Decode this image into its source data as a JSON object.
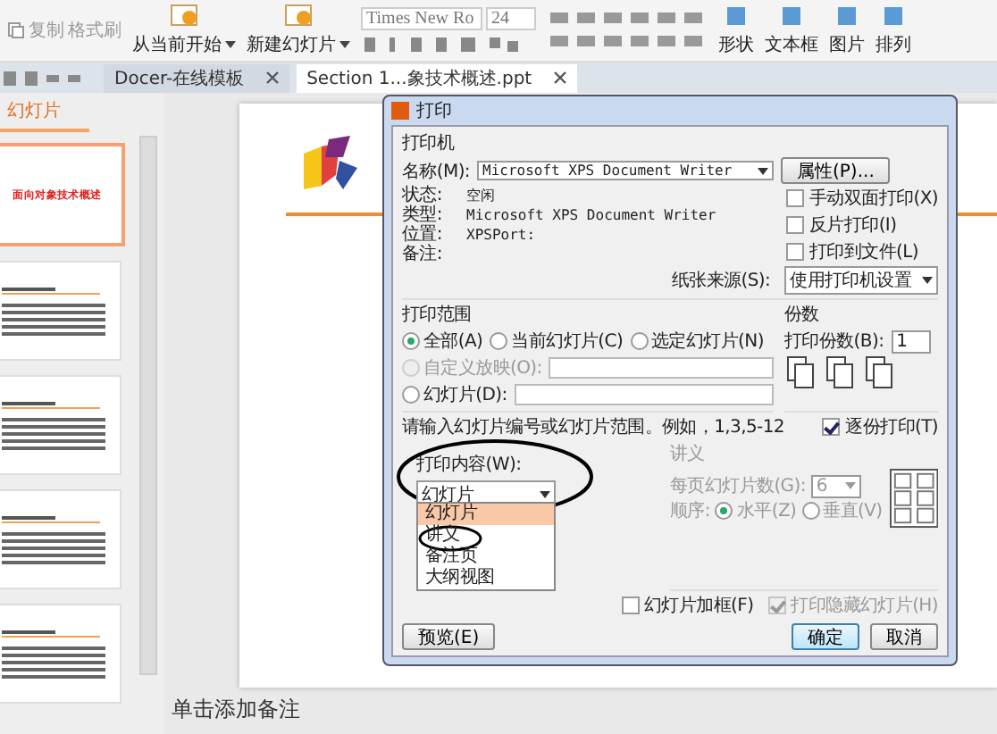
{
  "ribbon": {
    "clipboard": [
      "复制",
      "格式刷"
    ],
    "buttons": [
      {
        "label": "从当前开始"
      },
      {
        "label": "新建幻灯片"
      }
    ],
    "font": {
      "name": "Times New Ro",
      "size": "24"
    },
    "insert": [
      "形状",
      "文本框",
      "图片",
      "排列"
    ]
  },
  "tabs": [
    {
      "label": "Docer-在线模板",
      "selected": false
    },
    {
      "label": "Section 1...象技术概述.ppt",
      "selected": true
    }
  ],
  "sidebar": {
    "title": "幻灯片",
    "slides": [
      {
        "selected": true,
        "title": "面向对象技术概述"
      },
      {
        "selected": false
      },
      {
        "selected": false
      },
      {
        "selected": false
      },
      {
        "selected": false
      }
    ]
  },
  "notes": "单击添加备注",
  "dialog": {
    "title": "打印",
    "printer": {
      "heading": "打印机",
      "name_label": "名称(M):",
      "name": "Microsoft XPS Document Writer",
      "properties_button": "属性(P)...",
      "info": [
        {
          "label": "状态:",
          "value": "空闲"
        },
        {
          "label": "类型:",
          "value": "Microsoft XPS Document Writer"
        },
        {
          "label": "位置:",
          "value": "XPSPort:"
        },
        {
          "label": "备注:"
        }
      ],
      "options": [
        {
          "label": "手动双面打印(X)",
          "checked": false
        },
        {
          "label": "反片打印(I)",
          "checked": false
        },
        {
          "label": "打印到文件(L)",
          "checked": false
        }
      ],
      "source_label": "纸张来源(S):",
      "source": "使用打印机设置"
    },
    "range": {
      "heading": "打印范围",
      "choices": [
        {
          "label": "全部(A)",
          "selected": true,
          "disabled": false
        },
        {
          "label": "当前幻灯片(C)",
          "selected": false,
          "disabled": false
        },
        {
          "label": "选定幻灯片(N)",
          "selected": false,
          "disabled": false
        },
        {
          "label": "自定义放映(O):",
          "selected": false,
          "disabled": true
        },
        {
          "label": "幻灯片(D):",
          "selected": false,
          "disabled": false
        }
      ],
      "hint": "请输入幻灯片编号或幻灯片范围。例如，1,3,5-12"
    },
    "copies": {
      "heading": "份数",
      "label": "打印份数(B):",
      "value": "1",
      "collate": {
        "label": "逐份打印(T)",
        "checked": true
      }
    },
    "content": {
      "label": "打印内容(W):",
      "value": "幻灯片",
      "options": [
        {
          "label": "幻灯片",
          "selected": true
        },
        {
          "label": "讲义",
          "selected": false
        },
        {
          "label": "备注页",
          "selected": false
        },
        {
          "label": "大纲视图",
          "selected": false
        }
      ]
    },
    "handout": {
      "heading": "讲义",
      "disabled": true,
      "per_page_label": "每页幻灯片数(G):",
      "per_page": "6",
      "order_label": "顺序:",
      "orders": [
        {
          "label": "水平(Z)",
          "selected": true
        },
        {
          "label": "垂直(V)",
          "selected": false
        }
      ]
    },
    "frame": {
      "label": "幻灯片加框(F)",
      "checked": false,
      "disabled": false
    },
    "hidden": {
      "label": "打印隐藏幻灯片(H)",
      "checked": true,
      "disabled": true
    },
    "preview_button": "预览(E)",
    "ok_button": "确定",
    "cancel_button": "取消"
  }
}
